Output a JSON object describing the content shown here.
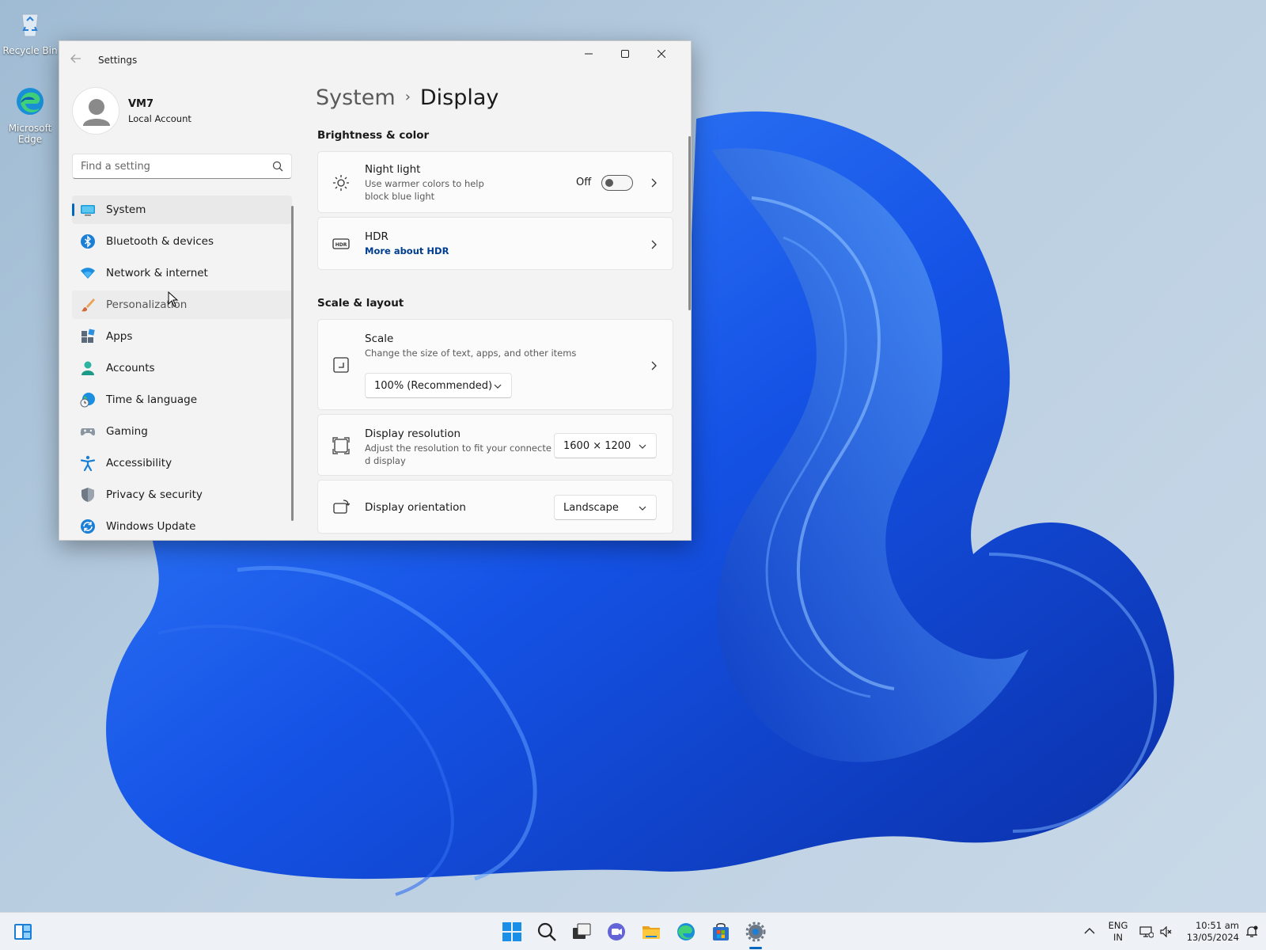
{
  "desktop": {
    "icons": [
      {
        "label": "Recycle Bin",
        "icon": "recycle-bin-icon"
      },
      {
        "label": "Microsoft Edge",
        "icon": "edge-icon"
      }
    ]
  },
  "window": {
    "title": "Settings",
    "controls": {
      "minimize": "minimize-icon",
      "maximize": "maximize-icon",
      "close": "close-icon"
    }
  },
  "profile": {
    "name": "VM7",
    "type": "Local Account"
  },
  "search": {
    "placeholder": "Find a setting"
  },
  "nav": {
    "items": [
      {
        "label": "System",
        "icon": "system-icon",
        "active": true
      },
      {
        "label": "Bluetooth & devices",
        "icon": "bluetooth-icon"
      },
      {
        "label": "Network & internet",
        "icon": "wifi-icon"
      },
      {
        "label": "Personalization",
        "icon": "brush-icon",
        "hover": true
      },
      {
        "label": "Apps",
        "icon": "apps-icon"
      },
      {
        "label": "Accounts",
        "icon": "accounts-icon"
      },
      {
        "label": "Time & language",
        "icon": "globe-clock-icon"
      },
      {
        "label": "Gaming",
        "icon": "gamepad-icon"
      },
      {
        "label": "Accessibility",
        "icon": "accessibility-icon"
      },
      {
        "label": "Privacy & security",
        "icon": "shield-icon"
      },
      {
        "label": "Windows Update",
        "icon": "update-icon"
      }
    ]
  },
  "breadcrumb": {
    "parent": "System",
    "separator": "›",
    "current": "Display"
  },
  "sections": {
    "brightness": "Brightness & color",
    "scale_layout": "Scale & layout"
  },
  "night_light": {
    "title": "Night light",
    "subtitle_line1": "Use warmer colors to help",
    "subtitle_line2": "block blue light",
    "state": "Off"
  },
  "hdr": {
    "title": "HDR",
    "link": "More about HDR"
  },
  "scale": {
    "title": "Scale",
    "subtitle": "Change the size of text, apps, and other items",
    "value": "100% (Recommended)"
  },
  "resolution": {
    "title": "Display resolution",
    "subtitle_line1": "Adjust the resolution to fit your connecte",
    "subtitle_line2": "d display",
    "value": "1600 × 1200"
  },
  "orientation": {
    "title": "Display orientation",
    "value": "Landscape"
  },
  "taskbar": {
    "widgets": "widgets-icon",
    "apps": [
      "start-icon",
      "search-icon",
      "task-view-icon",
      "chat-icon",
      "file-explorer-icon",
      "edge-icon",
      "store-icon",
      "settings-icon"
    ],
    "tray": {
      "lang_line1": "ENG",
      "lang_line2": "IN",
      "time": "10:51 am",
      "date": "13/05/2024"
    }
  },
  "colors": {
    "accent": "#0067c0",
    "link": "#003e92",
    "wallpaper": "#1a4ee8"
  }
}
